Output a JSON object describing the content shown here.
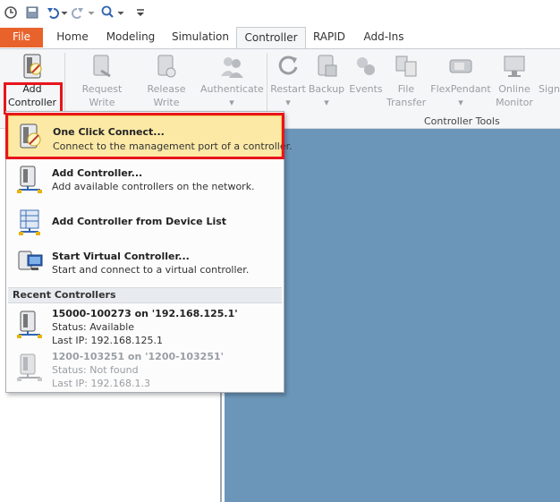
{
  "quick_access": {
    "icons": [
      "refresh-icon",
      "save-icon",
      "undo-icon",
      "redo-icon",
      "zoom-icon",
      "customize-icon"
    ]
  },
  "tabs": [
    {
      "label": "File"
    },
    {
      "label": "Home"
    },
    {
      "label": "Modeling"
    },
    {
      "label": "Simulation"
    },
    {
      "label": "Controller"
    },
    {
      "label": "RAPID"
    },
    {
      "label": "Add-Ins"
    }
  ],
  "ribbon": {
    "add_controller": {
      "line1": "Add",
      "line2": "Controller"
    },
    "request_write": {
      "line1": "Request",
      "line2": "Write Access"
    },
    "release_write": {
      "line1": "Release",
      "line2": "Write Access"
    },
    "authenticate": {
      "line1": "Authenticate"
    },
    "restart": {
      "line1": "Restart"
    },
    "backup": {
      "line1": "Backup"
    },
    "events": {
      "line1": "Events"
    },
    "file_transfer": {
      "line1": "File",
      "line2": "Transfer"
    },
    "flexpendant": {
      "line1": "FlexPendant"
    },
    "online_monitor": {
      "line1": "Online",
      "line2": "Monitor"
    },
    "signal": {
      "line1": "Sign"
    },
    "group_label": "Controller Tools"
  },
  "menu": {
    "items": [
      {
        "title": "One Click Connect...",
        "desc": "Connect to the management port of a controller."
      },
      {
        "title": "Add Controller...",
        "desc": "Add available controllers on the network."
      },
      {
        "title": "Add Controller from Device List",
        "desc": ""
      },
      {
        "title": "Start Virtual Controller...",
        "desc": "Start and connect to a virtual controller."
      }
    ],
    "recent_header": "Recent Controllers",
    "recent": [
      {
        "title": "15000-100273 on '192.168.125.1'",
        "status": "Status: Available",
        "ip": "Last IP: 192.168.125.1"
      },
      {
        "title": "1200-103251 on '1200-103251'",
        "status": "Status: Not found",
        "ip": "Last IP: 192.168.1.3"
      }
    ]
  },
  "colors": {
    "file_tab": "#e8632b",
    "highlight": "#e8141c",
    "hover": "#fce9a6",
    "canvas": "#6b96b9"
  }
}
